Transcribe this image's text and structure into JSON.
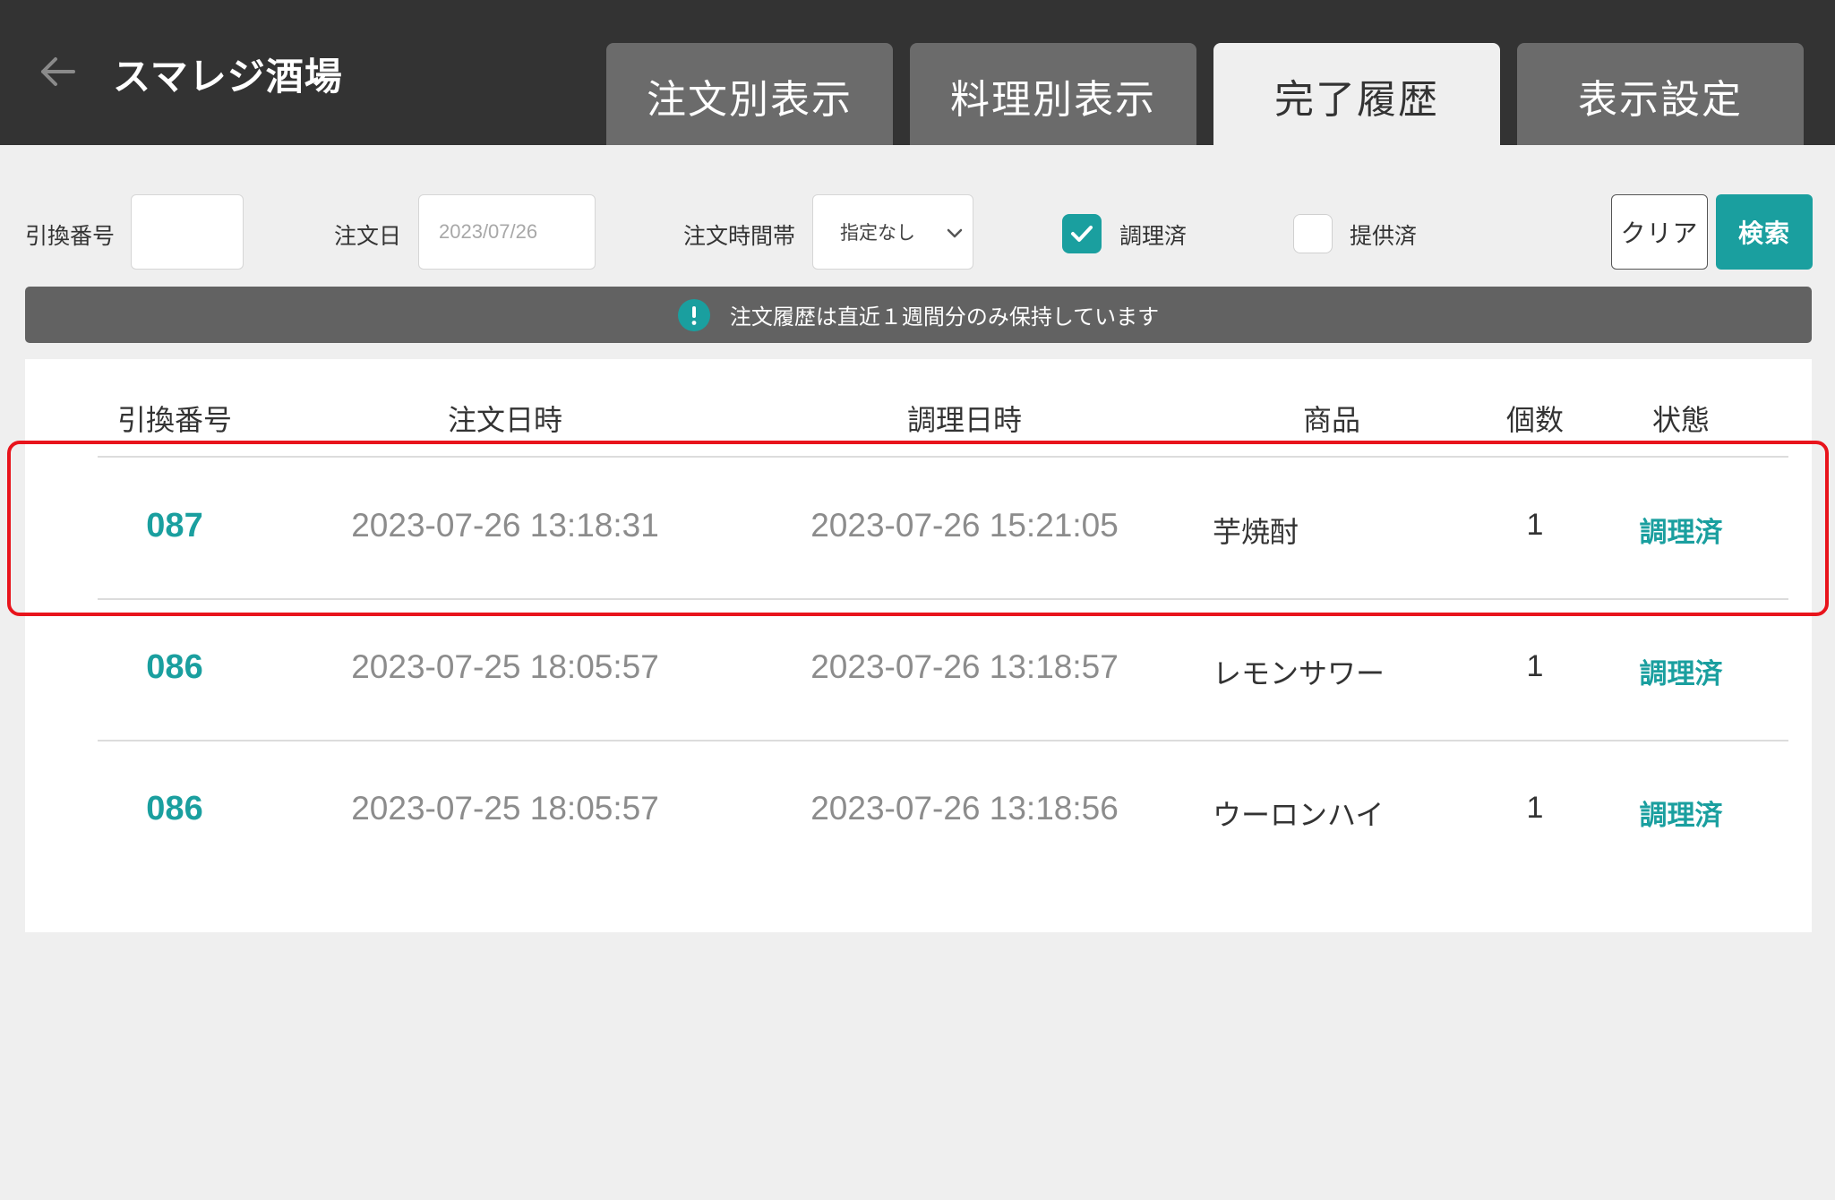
{
  "header": {
    "title": "スマレジ酒場",
    "back_icon": "arrow-left-icon",
    "tabs": [
      {
        "label": "注文別表示",
        "active": false
      },
      {
        "label": "料理別表示",
        "active": false
      },
      {
        "label": "完了履歴",
        "active": true
      },
      {
        "label": "表示設定",
        "active": false
      }
    ]
  },
  "filters": {
    "exchange_number_label": "引換番号",
    "exchange_number_value": "",
    "order_date_label": "注文日",
    "order_date_value": "2023/07/26",
    "time_slot_label": "注文時間帯",
    "time_slot_selected": "指定なし",
    "cooked_label": "調理済",
    "cooked_checked": true,
    "served_label": "提供済",
    "served_checked": false,
    "clear_label": "クリア",
    "search_label": "検索"
  },
  "notice": {
    "icon": "info-icon",
    "text": "注文履歴は直近１週間分のみ保持しています"
  },
  "table": {
    "headers": [
      "引換番号",
      "注文日時",
      "調理日時",
      "商品",
      "個数",
      "状態"
    ],
    "rows": [
      {
        "number": "087",
        "ordered_at": "2023-07-26 13:18:31",
        "cooked_at": "2023-07-26 15:21:05",
        "product": "芋焼酎",
        "qty": "1",
        "status": "調理済"
      },
      {
        "number": "086",
        "ordered_at": "2023-07-25 18:05:57",
        "cooked_at": "2023-07-26 13:18:57",
        "product": "レモンサワー",
        "qty": "1",
        "status": "調理済"
      },
      {
        "number": "086",
        "ordered_at": "2023-07-25 18:05:57",
        "cooked_at": "2023-07-26 13:18:56",
        "product": "ウーロンハイ",
        "qty": "1",
        "status": "調理済"
      }
    ]
  },
  "colors": {
    "header_bg": "#333333",
    "accent": "#1a9f9f",
    "highlight": "#e8141c",
    "page_bg": "#efefef"
  }
}
